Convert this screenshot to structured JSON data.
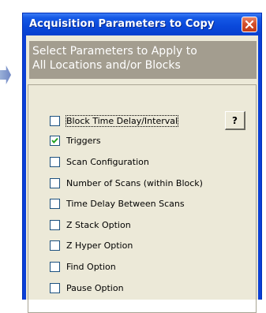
{
  "window": {
    "title": "Acquisition Parameters to Copy",
    "close_icon": "close-x-icon"
  },
  "header": {
    "line1": "Select Parameters to Apply to",
    "line2": "All Locations and/or Blocks"
  },
  "options": [
    {
      "label": "Block Time Delay/Interval",
      "checked": false
    },
    {
      "label": "Triggers",
      "checked": true
    },
    {
      "label": "Scan Configuration",
      "checked": false
    },
    {
      "label": "Number of Scans (within Block)",
      "checked": false
    },
    {
      "label": "Time Delay Between Scans",
      "checked": false
    },
    {
      "label": "Z Stack Option",
      "checked": false
    },
    {
      "label": "Z Hyper Option",
      "checked": false
    },
    {
      "label": "Find Option",
      "checked": false
    },
    {
      "label": "Pause Option",
      "checked": false
    }
  ],
  "help_button": {
    "label": "?"
  },
  "colors": {
    "title_bar": "#0a48da",
    "close_button": "#d2502c",
    "header_panel": "#a39d8f",
    "dialog_face": "#ece9d8"
  }
}
